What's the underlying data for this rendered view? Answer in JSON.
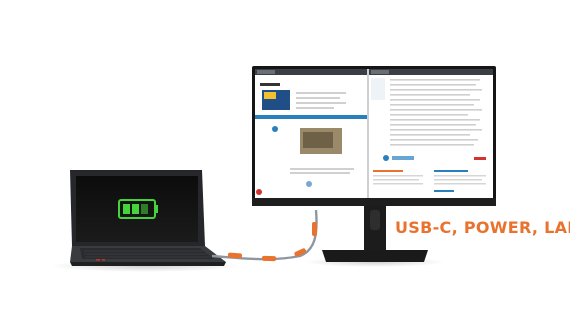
{
  "caption": {
    "text": "USB-C, POWER, LAN"
  },
  "colors": {
    "accent": "#e8722e",
    "battery": "#45d23a",
    "laptop_body": "#2c2d30",
    "monitor_frame": "#151515",
    "browser_bar": "#3b3f45",
    "site_blue": "#2a7fbf",
    "cable": "#8e97a0"
  },
  "icons": [
    "battery-icon"
  ]
}
